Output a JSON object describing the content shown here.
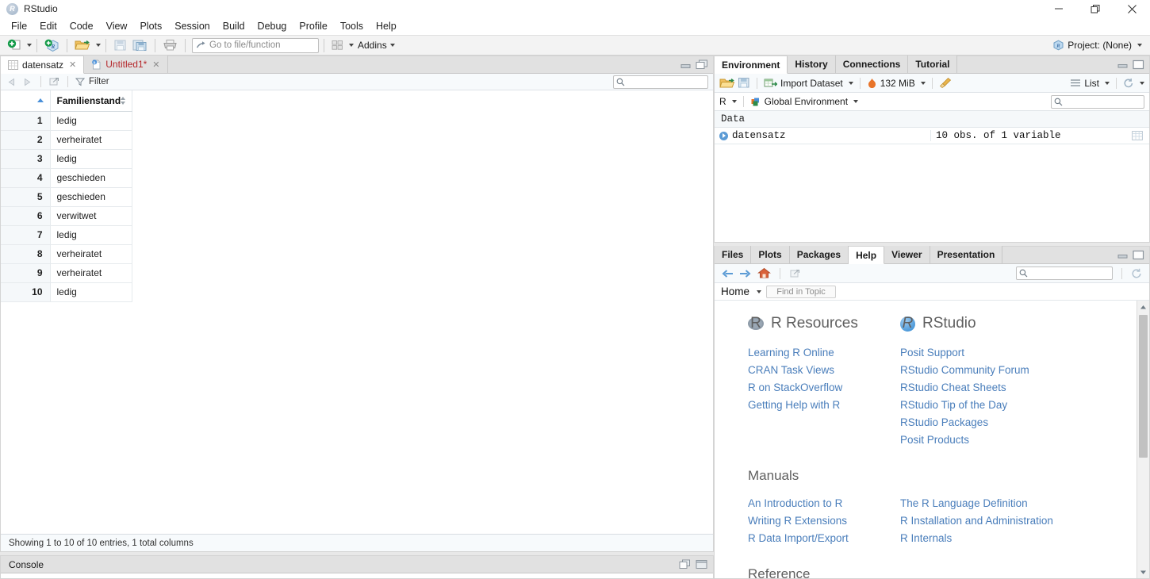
{
  "window": {
    "title": "RStudio",
    "app_icon": "r-logo-icon",
    "minimize": "minimize-icon",
    "maximize": "maximize-icon",
    "close": "close-icon"
  },
  "menubar": {
    "items": [
      "File",
      "Edit",
      "Code",
      "View",
      "Plots",
      "Session",
      "Build",
      "Debug",
      "Profile",
      "Tools",
      "Help"
    ]
  },
  "toolbar": {
    "new_file": "new-file-icon",
    "new_project": "new-project-icon",
    "open_file": "open-file-icon",
    "save": "save-icon",
    "save_all": "save-all-icon",
    "print": "print-icon",
    "goto_placeholder": "Go to file/function",
    "panes_icon": "panes-layout-icon",
    "addins_label": "Addins",
    "project_label": "Project: (None)",
    "project_icon": "project-cube-icon"
  },
  "source_pane": {
    "tabs": [
      {
        "label": "datensatz",
        "icon": "grid-icon",
        "active": true,
        "modified": false
      },
      {
        "label": "Untitled1*",
        "icon": "r-script-icon",
        "active": false,
        "modified": true
      }
    ],
    "controls": {
      "minimize": "minimize-pane-icon",
      "maximize": "maximize-pane-icon"
    }
  },
  "data_viewer": {
    "toolbar": {
      "back": "back-arrow-icon",
      "forward": "forward-arrow-icon",
      "popout": "popout-window-icon",
      "filter_label": "Filter",
      "filter_icon": "funnel-icon",
      "search_icon": "search-icon",
      "search_value": ""
    },
    "columns": [
      "",
      "Familienstand"
    ],
    "rows": [
      {
        "n": "1",
        "familienstand": "ledig"
      },
      {
        "n": "2",
        "familienstand": "verheiratet"
      },
      {
        "n": "3",
        "familienstand": "ledig"
      },
      {
        "n": "4",
        "familienstand": "geschieden"
      },
      {
        "n": "5",
        "familienstand": "geschieden"
      },
      {
        "n": "6",
        "familienstand": "verwitwet"
      },
      {
        "n": "7",
        "familienstand": "ledig"
      },
      {
        "n": "8",
        "familienstand": "verheiratet"
      },
      {
        "n": "9",
        "familienstand": "verheiratet"
      },
      {
        "n": "10",
        "familienstand": "ledig"
      }
    ],
    "status": "Showing 1 to 10 of 10 entries, 1 total columns"
  },
  "console_pane": {
    "title": "Console",
    "controls": {
      "restore": "restore-pane-icon",
      "maximize": "maximize-pane-icon"
    }
  },
  "environment_pane": {
    "tabs": [
      "Environment",
      "History",
      "Connections",
      "Tutorial"
    ],
    "active_tab": "Environment",
    "toolbar": {
      "load_workspace": "open-folder-icon",
      "save_workspace": "save-icon",
      "import_dataset": "Import Dataset",
      "import_icon": "import-dataset-icon",
      "memory_usage": "132 MiB",
      "memory_icon": "memory-flame-icon",
      "broom": "clear-broom-icon",
      "view_mode": "List",
      "view_mode_icon": "list-lines-icon",
      "refresh": "refresh-icon"
    },
    "context": {
      "language": "R",
      "scope": "Global Environment",
      "scope_icon": "cube-icon",
      "search_icon": "search-icon",
      "search_value": ""
    },
    "section_label": "Data",
    "objects": [
      {
        "name": "datensatz",
        "description": "10 obs. of 1 variable",
        "expand_icon": "expand-triangle-icon",
        "view_icon": "view-grid-icon"
      }
    ]
  },
  "help_pane": {
    "tabs": [
      "Files",
      "Plots",
      "Packages",
      "Help",
      "Viewer",
      "Presentation"
    ],
    "active_tab": "Help",
    "toolbar": {
      "back": "back-arrow-icon",
      "forward": "forward-arrow-icon",
      "home": "home-icon",
      "popout": "popout-window-icon",
      "search_icon": "search-icon",
      "search_value": "",
      "refresh": "refresh-icon"
    },
    "subbar": {
      "home_label": "Home",
      "find_in_topic_placeholder": "Find in Topic"
    },
    "content": {
      "sections": [
        {
          "title": "R Resources",
          "icon": "r-circle-icon",
          "links": [
            "Learning R Online",
            "CRAN Task Views",
            "R on StackOverflow",
            "Getting Help with R"
          ]
        },
        {
          "title": "RStudio",
          "icon": "rstudio-circle-icon",
          "links": [
            "Posit Support",
            "RStudio Community Forum",
            "RStudio Cheat Sheets",
            "RStudio Tip of the Day",
            "RStudio Packages",
            "Posit Products"
          ]
        }
      ],
      "manuals_title": "Manuals",
      "manuals_left": [
        "An Introduction to R",
        "Writing R Extensions",
        "R Data Import/Export"
      ],
      "manuals_right": [
        "The R Language Definition",
        "R Installation and Administration",
        "R Internals"
      ],
      "reference_title": "Reference"
    },
    "controls": {
      "minimize": "minimize-pane-icon",
      "maximize": "maximize-pane-icon"
    },
    "scrollbar": {
      "up": "scroll-up-icon",
      "down": "scroll-down-icon"
    }
  },
  "colors": {
    "accent_link": "#4a7ebb",
    "tab_bar": "#e1e1e1",
    "toolbar_bg": "#f3f3f3",
    "panel_header_bg": "#f7fafc",
    "sort_marker": "#4a90d9",
    "modified_tab": "#b5282c"
  }
}
